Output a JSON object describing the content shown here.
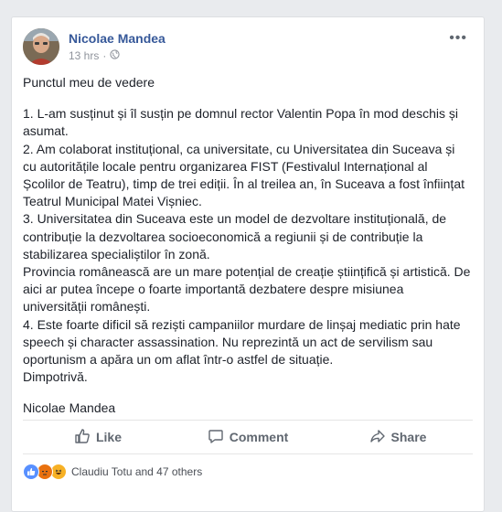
{
  "post": {
    "author": "Nicolae Mandea",
    "time": "13 hrs",
    "separator": "·",
    "heading": "Punctul meu de vedere",
    "lines": [
      "1. L-am susținut și îl susțin pe domnul rector Valentin Popa în mod deschis și asumat.",
      "2. Am colaborat instituțional, ca universitate, cu Universitatea din Suceava și cu autoritățile locale pentru organizarea FIST (Festivalul Internațional al Școlilor de Teatru), timp de trei ediții. În al treilea an, în Suceava a fost înființat Teatrul Municipal Matei Vișniec.",
      "3. Universitatea din Suceava este un model de dezvoltare instituțională, de contribuție la dezvoltarea socioeconomică a regiunii și de contribuție la stabilizarea specialiștilor în zonă.",
      "Provincia românească are un mare potențial de creație științifică și artistică. De aici ar putea începe o foarte importantă dezbatere despre misiunea universității românești.",
      "4. Este foarte dificil să reziști campaniilor murdare de linșaj mediatic prin hate speech și character assassination. Nu reprezintă un act de servilism sau oportunism a apăra un om aflat într-o astfel de situație.",
      "Dimpotrivă."
    ],
    "signature": "Nicolae Mandea"
  },
  "actions": {
    "like": "Like",
    "comment": "Comment",
    "share": "Share"
  },
  "reactions": {
    "text": "Claudiu Totu and 47 others"
  },
  "colors": {
    "link": "#365899",
    "muted": "#90949c",
    "like_blue": "#5890ff"
  }
}
